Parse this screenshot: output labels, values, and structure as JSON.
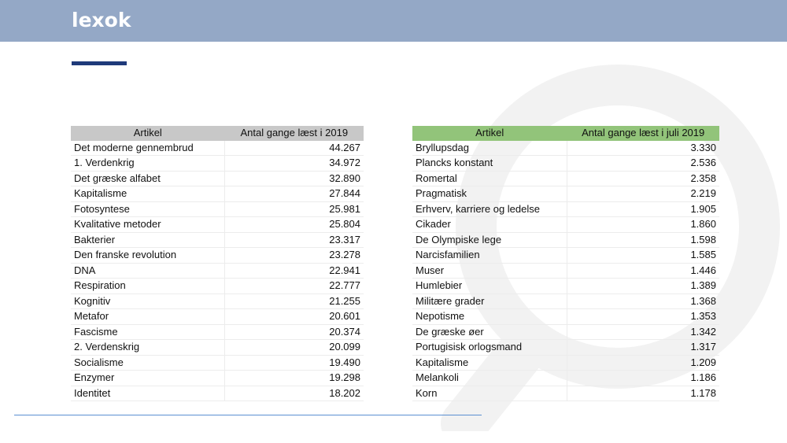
{
  "header": {
    "logo_text": "lexok",
    "bar_color": "#94a8c6",
    "accent_color": "#1f3a7a"
  },
  "table1": {
    "header_color": "#c8c8c8",
    "col1": "Artikel",
    "col2": "Antal gange læst i 2019",
    "rows": [
      [
        "Det moderne gennembrud",
        "44.267"
      ],
      [
        "1. Verdenkrig",
        "34.972"
      ],
      [
        "Det græske alfabet",
        "32.890"
      ],
      [
        "Kapitalisme",
        "27.844"
      ],
      [
        "Fotosyntese",
        "25.981"
      ],
      [
        "Kvalitative metoder",
        "25.804"
      ],
      [
        "Bakterier",
        "23.317"
      ],
      [
        "Den franske revolution",
        "23.278"
      ],
      [
        "DNA",
        "22.941"
      ],
      [
        "Respiration",
        "22.777"
      ],
      [
        "Kognitiv",
        "21.255"
      ],
      [
        "Metafor",
        "20.601"
      ],
      [
        "Fascisme",
        "20.374"
      ],
      [
        "2. Verdenskrig",
        "20.099"
      ],
      [
        "Socialisme",
        "19.490"
      ],
      [
        "Enzymer",
        "19.298"
      ],
      [
        "Identitet",
        "18.202"
      ]
    ]
  },
  "table2": {
    "header_color": "#92c47a",
    "col1": "Artikel",
    "col2": "Antal gange læst i juli 2019",
    "rows": [
      [
        "Bryllupsdag",
        "3.330"
      ],
      [
        "Plancks konstant",
        "2.536"
      ],
      [
        "Romertal",
        "2.358"
      ],
      [
        "Pragmatisk",
        "2.219"
      ],
      [
        "Erhverv, karriere og ledelse",
        "1.905"
      ],
      [
        "Cikader",
        "1.860"
      ],
      [
        "De Olympiske lege",
        "1.598"
      ],
      [
        "Narcisfamilien",
        "1.585"
      ],
      [
        "Muser",
        "1.446"
      ],
      [
        "Humlebier",
        "1.389"
      ],
      [
        "Militære grader",
        "1.368"
      ],
      [
        "Nepotisme",
        "1.353"
      ],
      [
        "De græske øer",
        "1.342"
      ],
      [
        "Portugisisk orlogsmand",
        "1.317"
      ],
      [
        "Kapitalisme",
        "1.209"
      ],
      [
        "Melankoli",
        "1.186"
      ],
      [
        "Korn",
        "1.178"
      ]
    ]
  }
}
